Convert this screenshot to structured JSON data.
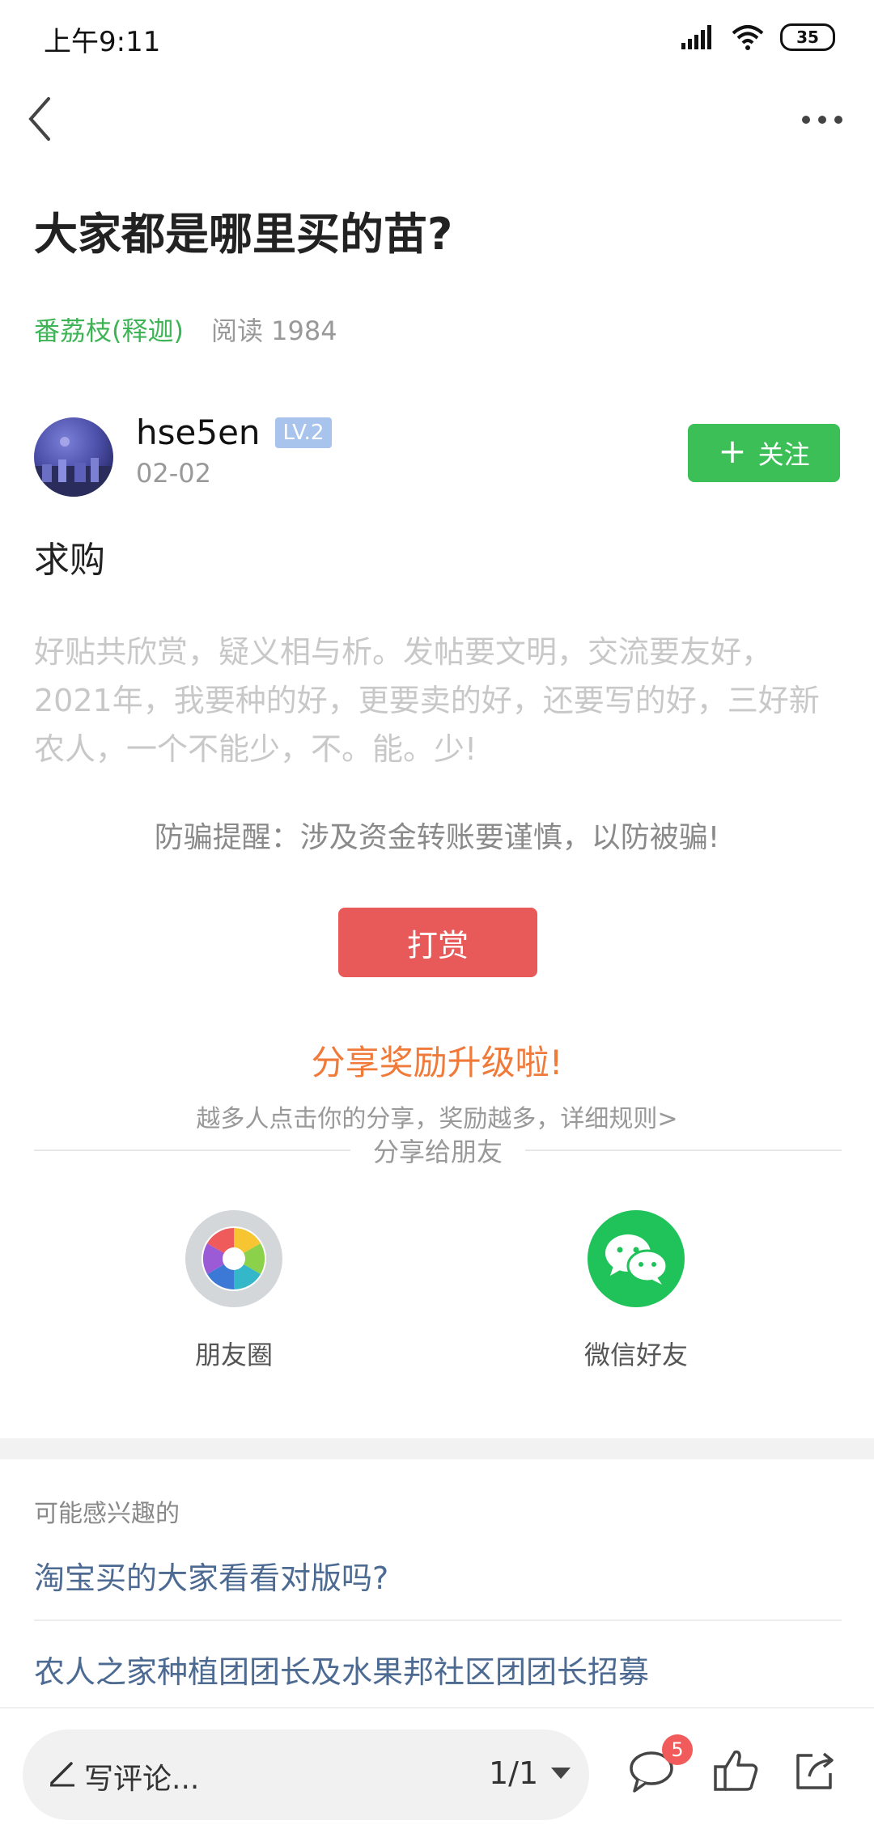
{
  "status_bar": {
    "time": "上午9:11",
    "battery": "35",
    "icons": [
      "signal-icon",
      "wifi-icon",
      "battery-icon"
    ]
  },
  "nav": {
    "back_icon": "chevron-left-icon",
    "more_icon": "more-dots-icon"
  },
  "post": {
    "title": "大家都是哪里买的苗?",
    "category": "番荔枝(释迦)",
    "reads": "阅读 1984",
    "body": "求购"
  },
  "author": {
    "name": "hse5en",
    "level": "LV.2",
    "date": "02-02",
    "follow_label": "关注"
  },
  "slogan": "好贴共欣赏，疑义相与析。发帖要文明，交流要友好，2021年，我要种的好，更要卖的好，还要写的好，三好新农人，一个不能少，不。能。少!",
  "anti_fraud": "防骗提醒：涉及资金转账要谨慎，以防被骗!",
  "reward_label": "打赏",
  "share": {
    "title": "分享奖励升级啦!",
    "subtitle": "越多人点击你的分享，奖励越多，详细规则>",
    "divider_label": "分享给朋友",
    "moments_label": "朋友圈",
    "wechat_label": "微信好友"
  },
  "recommend": {
    "header": "可能感兴趣的",
    "items": [
      "淘宝买的大家看看对版吗?",
      "农人之家种植团团长及水果邦社区团团长招募"
    ]
  },
  "bottom_bar": {
    "comment_placeholder": "写评论...",
    "page": "1/1",
    "comment_count": "5"
  },
  "colors": {
    "green": "#3dbf57",
    "category_green": "#3fb457",
    "reward_red": "#e85a5a",
    "share_orange": "#f07a3a",
    "link_blue": "#4c6a92",
    "badge_red": "#f15b5b"
  }
}
